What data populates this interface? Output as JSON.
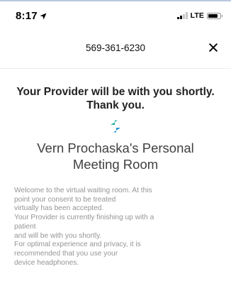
{
  "status_bar": {
    "time": "8:17",
    "network": "LTE"
  },
  "header": {
    "title": "569-361-6230"
  },
  "main": {
    "status_message_lines": [
      "Your Provider will be with you shortly.",
      "Thank you."
    ],
    "room_title_lines": [
      "Vern Prochaska's Personal",
      "Meeting Room"
    ],
    "welcome_lines": [
      "Welcome to the virtual waiting room. At this",
      "point your consent to be treated",
      "virtually has been accepted.",
      "Your Provider is currently finishing up with a",
      "patient",
      "and will be with you shortly.",
      "For optimal experience and privacy, it is",
      "recommended that you use your",
      "device headphones."
    ]
  },
  "icons": {
    "location": "location-arrow-icon",
    "close": "close-icon",
    "logo": "medical-cross-logo"
  },
  "colors": {
    "logo_teal": "#2bb1a3",
    "logo_blue": "#1e8fd0",
    "body_text": "#959595"
  }
}
